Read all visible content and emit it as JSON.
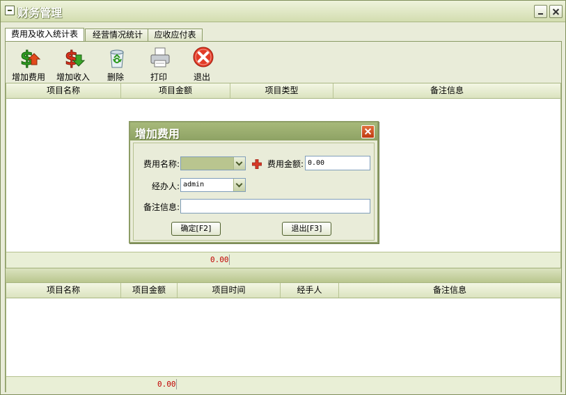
{
  "window": {
    "title": "财务管理"
  },
  "tabs": [
    {
      "label": "费用及收入统计表",
      "active": true
    },
    {
      "label": "经营情况统计",
      "active": false
    },
    {
      "label": "应收应付表",
      "active": false
    }
  ],
  "toolbar": {
    "items": [
      {
        "label": "增加费用",
        "icon": "add-expense-icon"
      },
      {
        "label": "增加收入",
        "icon": "add-income-icon"
      },
      {
        "label": "删除",
        "icon": "recycle-bin-icon"
      },
      {
        "label": "打印",
        "icon": "printer-icon"
      },
      {
        "label": "退出",
        "icon": "exit-icon"
      }
    ]
  },
  "top_grid": {
    "columns": [
      "项目名称",
      "项目金额",
      "项目类型",
      "备注信息"
    ],
    "rows": [],
    "total": "0.00"
  },
  "bottom_grid": {
    "columns": [
      "项目名称",
      "项目金额",
      "项目时间",
      "经手人",
      "备注信息"
    ],
    "rows": [],
    "total": "0.00"
  },
  "dialog": {
    "title": "增加费用",
    "fee_name_label": "费用名称:",
    "fee_name_value": "",
    "fee_amount_label": "费用金额:",
    "fee_amount_value": "0.00",
    "handler_label": "经办人:",
    "handler_value": "admin",
    "remark_label": "备注信息:",
    "remark_value": "",
    "confirm_label": "确定[F2]",
    "exit_label": "退出[F3]"
  },
  "colors": {
    "title_green": "#8ea264",
    "total_red": "#c00000",
    "add_green": "#2e9a1f",
    "delete_red": "#d8321c"
  }
}
